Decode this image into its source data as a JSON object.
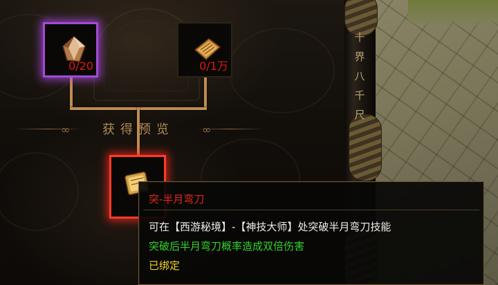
{
  "materials": [
    {
      "icon": "crystal-ore-icon",
      "count": "0/20"
    },
    {
      "icon": "scroll-bundle-icon",
      "count": "0/1万"
    }
  ],
  "preview": {
    "label": "获得预览",
    "icon": "skill-book-icon"
  },
  "tooltip": {
    "name": "突-半月弯刀",
    "description": "可在【西游秘境】-【神技大师】处突破半月弯刀技能",
    "effect": "突破后半月弯刀概率造成双倍伤害",
    "status": "已绑定"
  },
  "pillar_glyphs": "十界八千尺",
  "colors": {
    "count": "#e21b12",
    "tooltip_name": "#e3281c",
    "tooltip_effect": "#33d42a",
    "tooltip_status": "#f3d12b",
    "slot_selected_glow": "#a24ad8",
    "slot_reward_glow": "#ff3a2a",
    "connector": "#c08c52"
  }
}
